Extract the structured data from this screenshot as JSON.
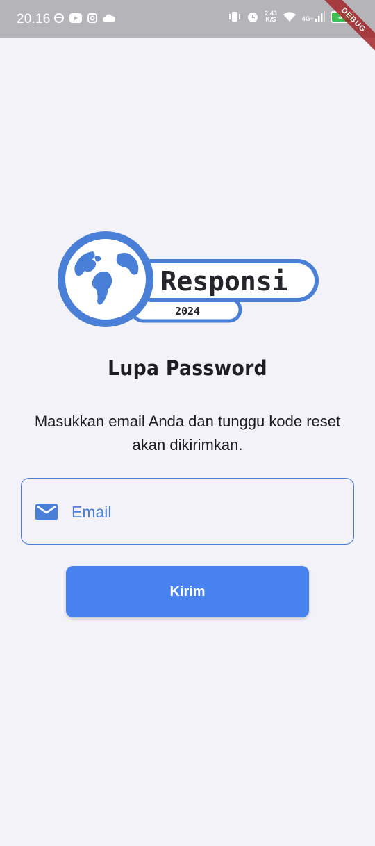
{
  "status_bar": {
    "time": "20.16",
    "net_speed_value": "2,43",
    "net_speed_unit": "K/S",
    "network_type": "4G+",
    "battery_level": "34"
  },
  "debug_banner": "DEBUG",
  "logo": {
    "wordmark": "Responsi",
    "year": "2024"
  },
  "page": {
    "title": "Lupa Password",
    "instruction": "Masukkan email Anda dan tunggu kode reset akan dikirimkan."
  },
  "form": {
    "email_placeholder": "Email",
    "email_value": "",
    "submit_label": "Kirim"
  },
  "colors": {
    "primary": "#4882ee",
    "field_border": "#4a7fd8",
    "background": "#f3f2f8",
    "status_bar": "#b5b4b9"
  }
}
